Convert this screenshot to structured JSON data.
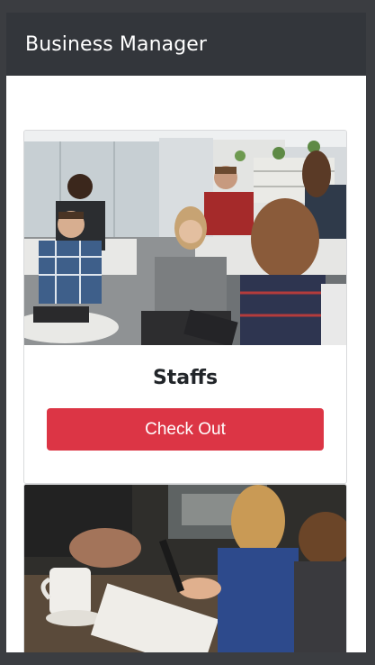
{
  "navbar": {
    "brand": "Business Manager"
  },
  "cards": [
    {
      "title": "Staffs",
      "button_label": "Check Out",
      "image": "team-meeting-photo"
    },
    {
      "image": "desk-writing-photo"
    }
  ],
  "colors": {
    "navbar": "#33363b",
    "button": "#dc3545",
    "frame": "#3b3d41"
  }
}
